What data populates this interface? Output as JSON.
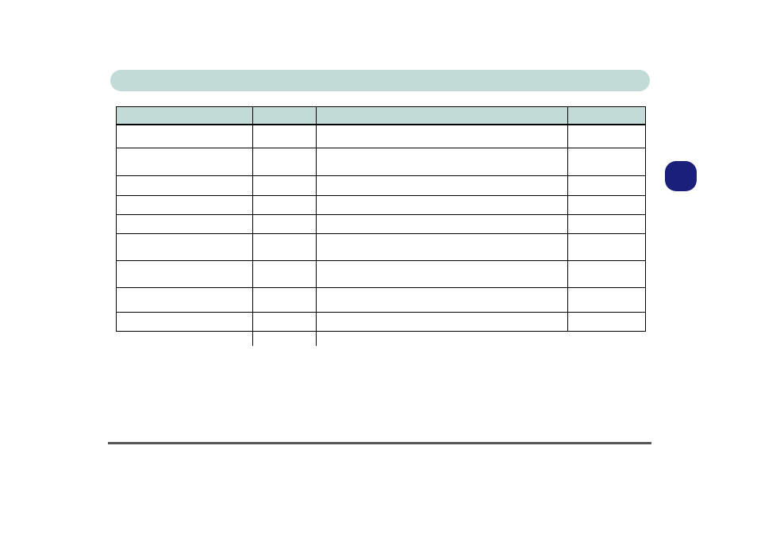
{
  "title": "",
  "side_tab_label": "",
  "table": {
    "headers": [
      "",
      "",
      "",
      ""
    ],
    "rows": [
      [
        "",
        "",
        "",
        ""
      ],
      [
        "",
        "",
        "",
        ""
      ],
      [
        "",
        "",
        "",
        ""
      ],
      [
        "",
        "",
        "",
        ""
      ],
      [
        "",
        "",
        "",
        ""
      ],
      [
        "",
        "",
        "",
        ""
      ],
      [
        "",
        "",
        "",
        ""
      ],
      [
        "",
        "",
        "",
        ""
      ],
      [
        "",
        "",
        "",
        ""
      ],
      [
        "",
        "",
        "",
        ""
      ]
    ]
  }
}
